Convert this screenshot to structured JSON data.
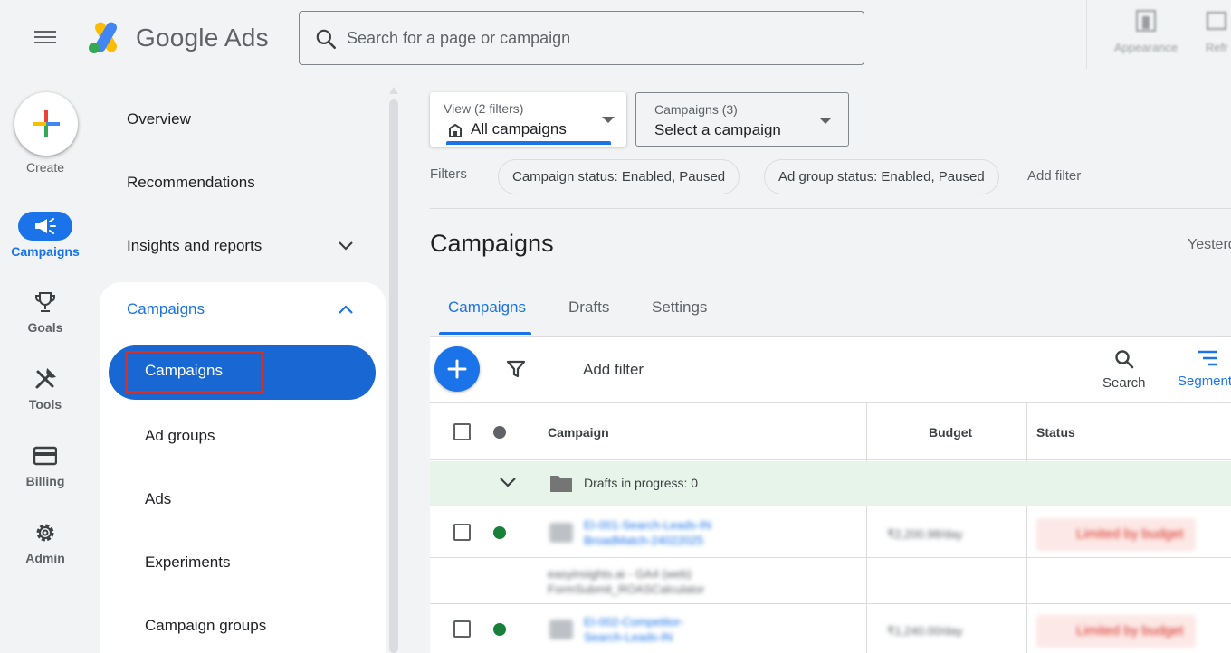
{
  "app": {
    "brand": "Google Ads",
    "search_placeholder": "Search for a page or campaign",
    "appearance_label": "Appearance",
    "refresh_label": "Refr"
  },
  "rail": {
    "create": "Create",
    "items": [
      {
        "label": "Campaigns",
        "icon": "campaigns-megaphone-icon",
        "active": true
      },
      {
        "label": "Goals",
        "icon": "trophy-icon",
        "active": false
      },
      {
        "label": "Tools",
        "icon": "tools-icon",
        "active": false
      },
      {
        "label": "Billing",
        "icon": "credit-card-icon",
        "active": false
      },
      {
        "label": "Admin",
        "icon": "gear-icon",
        "active": false
      }
    ]
  },
  "nav": {
    "overview": "Overview",
    "recommendations": "Recommendations",
    "insights": "Insights and reports",
    "group_title": "Campaigns",
    "active_item": "Campaigns",
    "sub_items": [
      "Ad groups",
      "Ads",
      "Experiments",
      "Campaign groups"
    ]
  },
  "view_selector": {
    "small": "View (2 filters)",
    "value": "All campaigns"
  },
  "campaign_selector": {
    "small": "Campaigns (3)",
    "value": "Select a campaign"
  },
  "filters": {
    "label": "Filters",
    "chips": [
      "Campaign status: Enabled, Paused",
      "Ad group status: Enabled, Paused"
    ],
    "add": "Add filter"
  },
  "page": {
    "title": "Campaigns",
    "date_range": "Yesterday"
  },
  "tabs": [
    "Campaigns",
    "Drafts",
    "Settings"
  ],
  "toolbar": {
    "add_filter": "Add filter",
    "search": "Search",
    "segment": "Segment"
  },
  "table": {
    "headers": {
      "campaign": "Campaign",
      "budget": "Budget",
      "status": "Status"
    },
    "drafts": "Drafts in progress: 0",
    "rows": [
      {
        "name_line1": "EI-001-Search-Leads-IN",
        "name_line2": "BroadMatch-24022025",
        "budget": "₹2,200.98/day",
        "status": "Limited by budget"
      },
      {
        "name_line1": "EI-002-Competitor-",
        "name_line2": "Search-Leads-IN",
        "budget": "₹1,240.00/day",
        "status": "Limited by budget"
      }
    ],
    "conversion_text_line1": "easyinsights.ai - GA4 (web)",
    "conversion_text_line2": "FormSubmit_ROASCalculator"
  },
  "colors": {
    "accent": "#1a73e8",
    "active_nav": "#1967d2",
    "enabled_dot": "#188038",
    "drafts_bg": "#e6f4ea",
    "limited_bg": "#fce8e6"
  }
}
